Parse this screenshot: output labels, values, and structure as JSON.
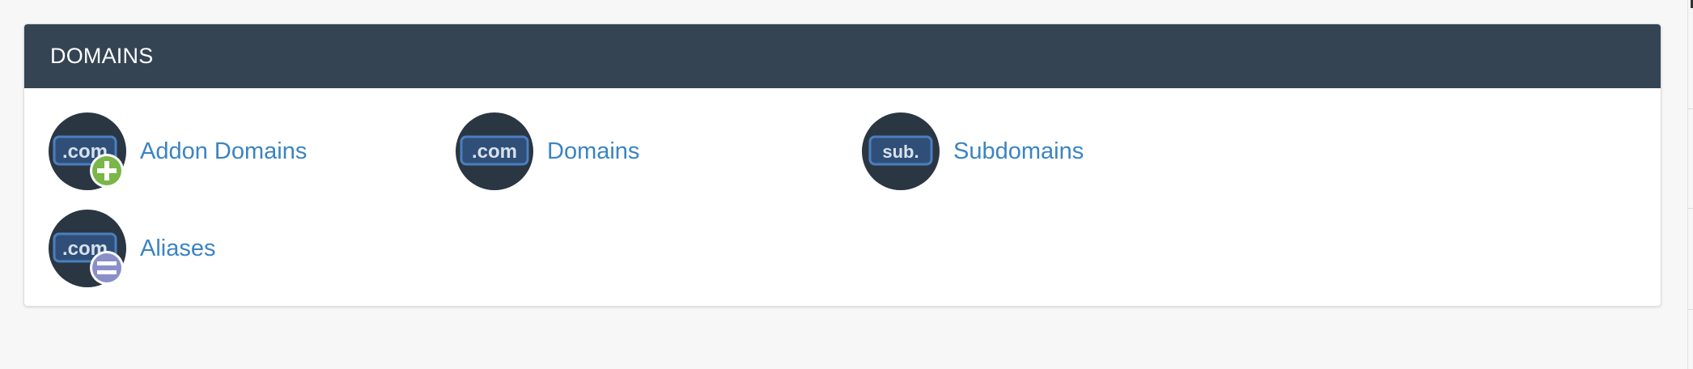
{
  "section": {
    "title": "DOMAINS"
  },
  "items": [
    {
      "label": "Addon Domains",
      "icon": "addon-domains-icon",
      "icon_text": ".com",
      "badge": "plus"
    },
    {
      "label": "Domains",
      "icon": "domains-icon",
      "icon_text": ".com",
      "badge": null
    },
    {
      "label": "Subdomains",
      "icon": "subdomains-icon",
      "icon_text": "sub.",
      "badge": null
    },
    {
      "label": "Aliases",
      "icon": "aliases-icon",
      "icon_text": ".com",
      "badge": "equals"
    }
  ],
  "colors": {
    "header_bg": "#354453",
    "link": "#3b84c2",
    "icon_circle": "#2b3643",
    "icon_box": "#2f4f78",
    "icon_box_border": "#4a7fbf",
    "badge_plus": "#7ab648",
    "badge_equals": "#8b8fc8"
  }
}
